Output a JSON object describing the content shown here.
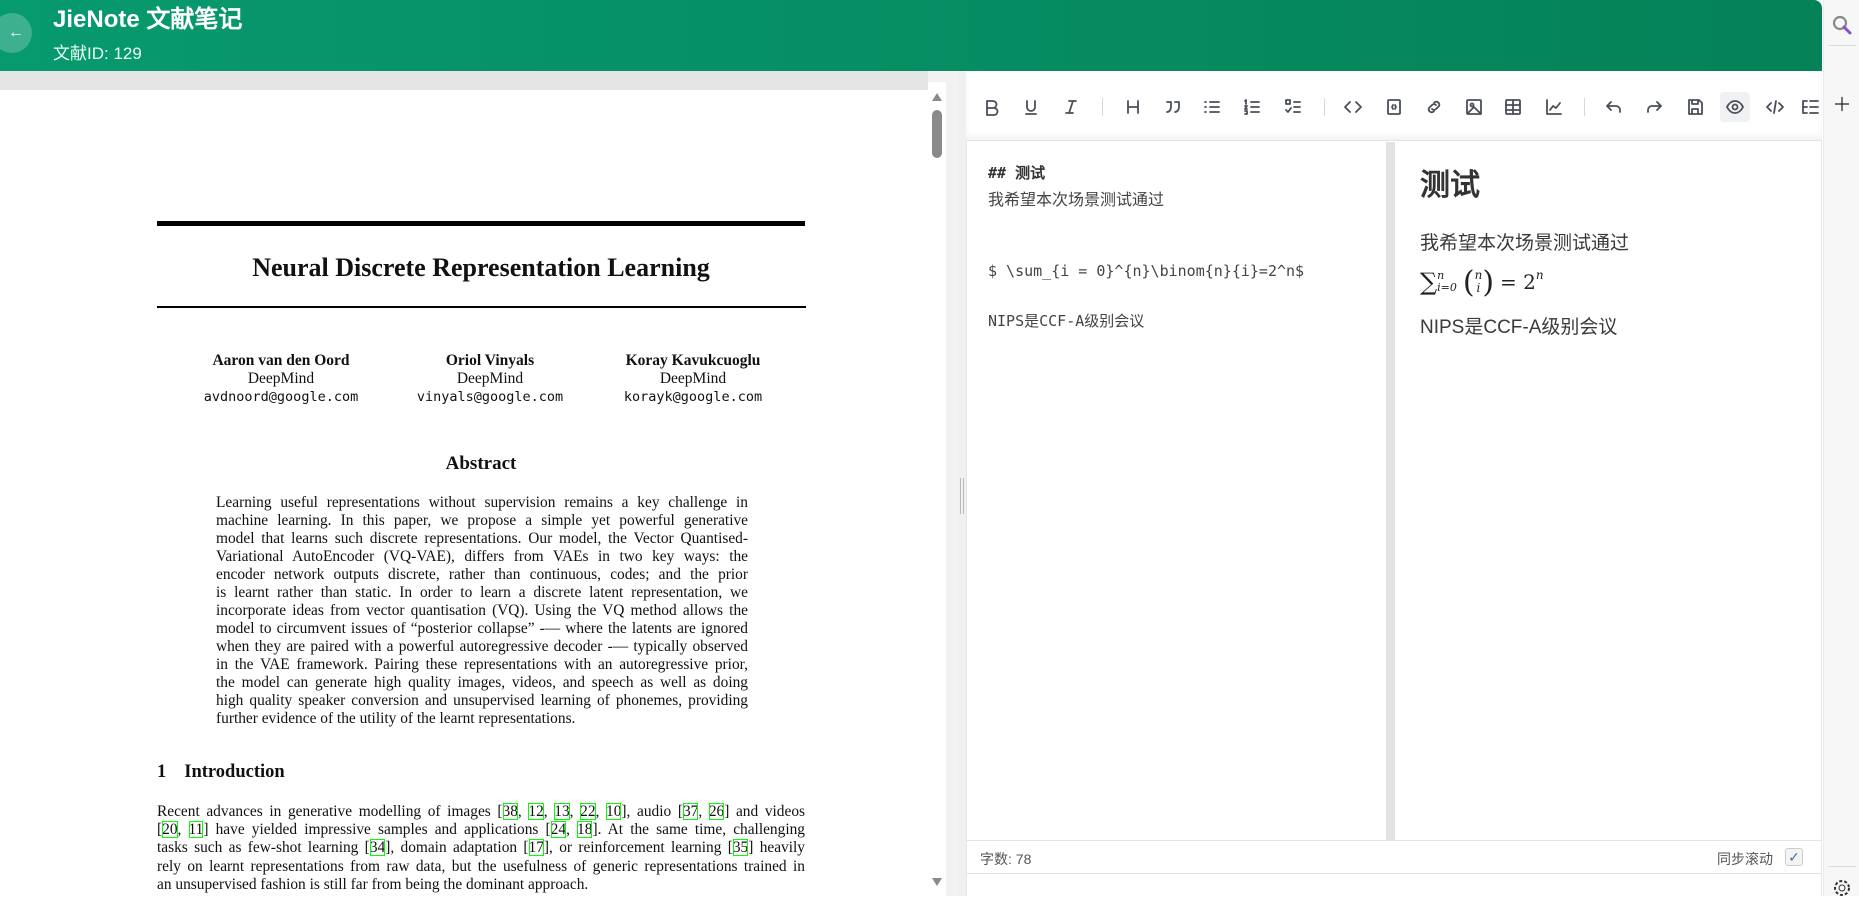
{
  "header": {
    "title": "JieNote 文献笔记",
    "subtitle": "文献ID: 129",
    "back_icon": "arrow-left-icon",
    "color": "#07946a"
  },
  "paper": {
    "title": "Neural Discrete Representation Learning",
    "authors": [
      {
        "name": "Aaron van den Oord",
        "affiliation": "DeepMind",
        "email": "avdnoord@google.com"
      },
      {
        "name": "Oriol Vinyals",
        "affiliation": "DeepMind",
        "email": "vinyals@google.com"
      },
      {
        "name": "Koray Kavukcuoglu",
        "affiliation": "DeepMind",
        "email": "korayk@google.com"
      }
    ],
    "abstract_heading": "Abstract",
    "abstract_lines": [
      "Learning useful representations without supervision remains a key challenge in",
      "machine learning.  In this paper, we propose a simple yet powerful generative",
      "model that learns such discrete representations. Our model, the Vector Quantised-",
      "Variational AutoEncoder (VQ-VAE), differs from VAEs in two key ways:  the",
      "encoder network outputs discrete, rather than continuous, codes; and the prior",
      "is learnt rather than static.  In order to learn a discrete latent representation, we",
      "incorporate ideas from vector quantisation (VQ). Using the VQ method allows the",
      "model to circumvent issues of “posterior collapse” -— where the latents are ignored",
      "when they are paired with a powerful autoregressive decoder -— typically observed",
      "in the VAE framework. Pairing these representations with an autoregressive prior,",
      "the model can generate high quality images, videos, and speech as well as doing",
      "high quality speaker conversion and unsupervised learning of phonemes, providing",
      "further evidence of the utility of the learnt representations."
    ],
    "section_number": "1",
    "section_title": "Introduction",
    "intro_lines": [
      [
        "Recent advances in generative modelling of images [",
        {
          "c": "38"
        },
        ", ",
        {
          "c": "12"
        },
        ", ",
        {
          "c": "13"
        },
        ", ",
        {
          "c": "22"
        },
        ", ",
        {
          "c": "10"
        },
        "], audio [",
        {
          "c": "37"
        },
        ", ",
        {
          "c": "26"
        },
        "] and videos"
      ],
      [
        "[",
        {
          "c": "20"
        },
        ", ",
        {
          "c": "11"
        },
        "] have yielded impressive samples and applications [",
        {
          "c": "24"
        },
        ", ",
        {
          "c": "18"
        },
        "]. At the same time, challenging"
      ],
      [
        "tasks such as few-shot learning [",
        {
          "c": "34"
        },
        "], domain adaptation [",
        {
          "c": "17"
        },
        "], or reinforcement learning [",
        {
          "c": "35"
        },
        "] heavily"
      ],
      [
        "rely on learnt representations from raw data, but the usefulness of generic representations trained in"
      ],
      [
        "an unsupervised fashion is still far from being the dominant approach."
      ]
    ]
  },
  "toolbar": {
    "buttons": [
      {
        "name": "bold",
        "icon": "bold-icon"
      },
      {
        "name": "underline",
        "icon": "underline-icon"
      },
      {
        "name": "italic",
        "icon": "italic-icon"
      },
      {
        "name": "heading",
        "icon": "heading-icon"
      },
      {
        "name": "quote",
        "icon": "quote-icon"
      },
      {
        "name": "unordered-list",
        "icon": "list-icon"
      },
      {
        "name": "ordered-list",
        "icon": "ordered-list-icon"
      },
      {
        "name": "task-list",
        "icon": "task-list-icon"
      },
      {
        "name": "inline-code",
        "icon": "code-icon"
      },
      {
        "name": "code-block",
        "icon": "code-block-icon"
      },
      {
        "name": "link",
        "icon": "link-icon"
      },
      {
        "name": "image",
        "icon": "image-icon"
      },
      {
        "name": "table",
        "icon": "table-icon"
      },
      {
        "name": "chart",
        "icon": "chart-icon"
      },
      {
        "name": "undo",
        "icon": "undo-icon"
      },
      {
        "name": "redo",
        "icon": "redo-icon"
      },
      {
        "name": "save",
        "icon": "save-icon"
      },
      {
        "name": "preview",
        "icon": "eye-icon",
        "active": true
      },
      {
        "name": "html-code",
        "icon": "html-code-icon"
      },
      {
        "name": "catalog",
        "icon": "catalog-icon"
      }
    ]
  },
  "editor": {
    "source_lines": {
      "heading": "## 测试",
      "para": "我希望本次场景测试通过",
      "math": "$ \\sum_{i = 0}^{n}\\binom{n}{i}=2^n$",
      "note": "NIPS是CCF-A级别会议"
    },
    "preview": {
      "heading": "测试",
      "para": "我希望本次场景测试通过",
      "math_sum": "∑",
      "math_sup": "n",
      "math_sub": "i=0",
      "binom_top": "n",
      "binom_bot": "i",
      "math_eq": "= 2",
      "math_exp": "n",
      "note": "NIPS是CCF-A级别会议"
    },
    "status": {
      "word_count": "字数: 78",
      "sync_scroll": "同步滚动",
      "sync_checked": true,
      "check": "✓"
    }
  },
  "browser_sidebar": {
    "icons": [
      "search-icon",
      "plus-icon",
      "gear-icon"
    ]
  }
}
